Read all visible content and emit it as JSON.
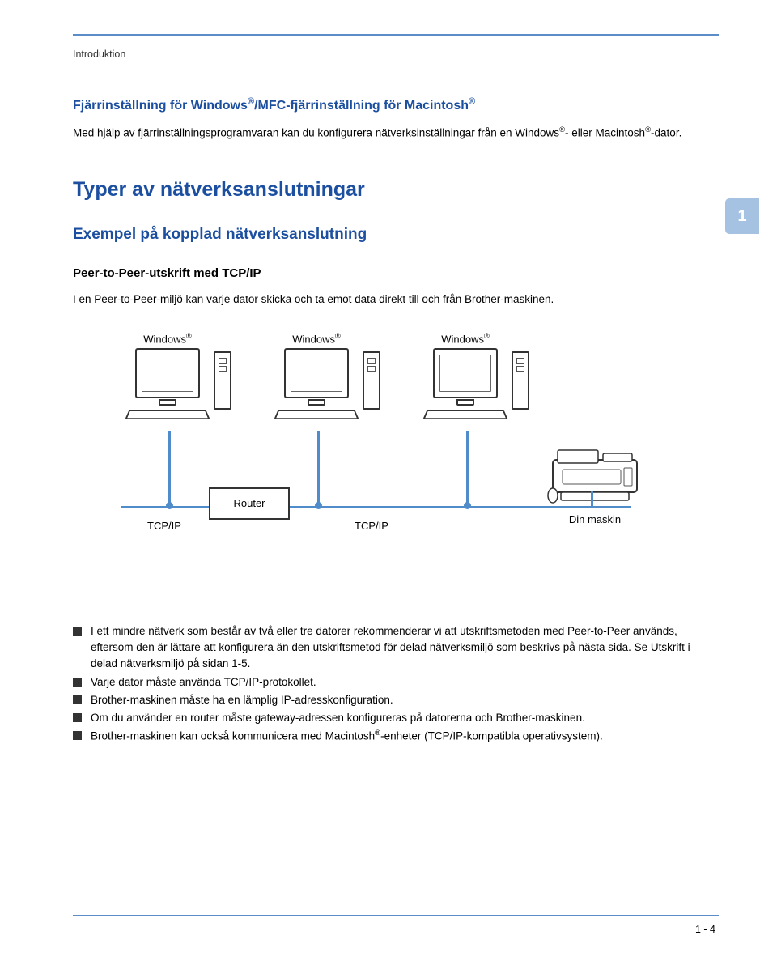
{
  "breadcrumb": "Introduktion",
  "tab": "1",
  "section": {
    "title": "Fjärrinställning för Windows®/MFC-fjärrinställning för Macintosh®",
    "body": "Med hjälp av fjärrinställningsprogramvaran kan du konfigurera nätverksinställningar från en Windows®- eller Macintosh®-dator."
  },
  "h1": "Typer av nätverksanslutningar",
  "h2": "Exempel på kopplad nätverksanslutning",
  "h4": "Peer-to-Peer-utskrift med TCP/IP",
  "intro": "I en Peer-to-Peer-miljö kan varje dator skicka och ta emot data direkt till och från Brother-maskinen.",
  "diagram": {
    "pc1": "Windows®",
    "pc2": "Windows®",
    "pc3": "Windows®",
    "router": "Router",
    "tcpip_left": "TCP/IP",
    "tcpip_right": "TCP/IP",
    "printer": "Din maskin"
  },
  "bullets": [
    "I ett mindre nätverk som består av två eller tre datorer rekommenderar vi att utskriftsmetoden med Peer-to-Peer används, eftersom den är lättare att konfigurera än den utskriftsmetod för delad nätverksmiljö som beskrivs på nästa sida. Se Utskrift i delad nätverksmiljö på sidan 1-5.",
    "Varje dator måste använda TCP/IP-protokollet.",
    "Brother-maskinen måste ha en lämplig IP-adresskonfiguration.",
    "Om du använder en router måste gateway-adressen konfigureras på datorerna och Brother-maskinen.",
    "Brother-maskinen kan också kommunicera med Macintosh®-enheter (TCP/IP-kompatibla operativsystem)."
  ],
  "page_number": "1 - 4"
}
